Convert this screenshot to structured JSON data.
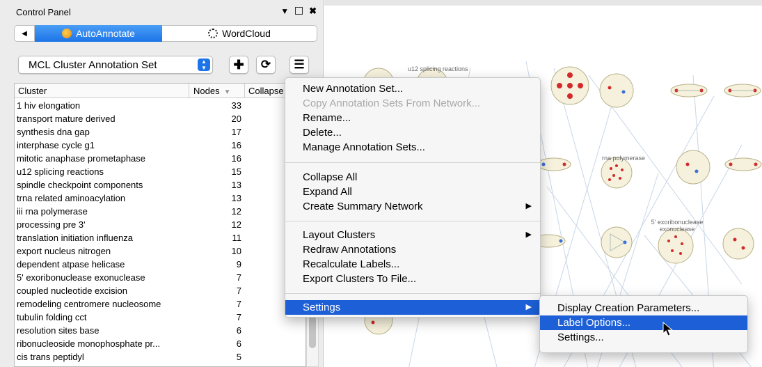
{
  "control_panel": {
    "title": "Control Panel",
    "header_icons": [
      "chevron-down-icon",
      "float-window-icon",
      "close-icon"
    ],
    "tabs": {
      "back_glyph": "◀",
      "autoannotate_label": "AutoAnnotate",
      "wordcloud_label": "WordCloud",
      "active": "AutoAnnotate"
    },
    "annotation_set_select": {
      "value": "MCL Cluster Annotation Set"
    },
    "toolbar_buttons": [
      "add-icon",
      "refresh-icon",
      "menu-icon"
    ],
    "table": {
      "columns": [
        "Cluster",
        "Nodes",
        "Collapse"
      ],
      "sort_column": "Nodes",
      "rows": [
        {
          "cluster": "1 hiv elongation",
          "nodes": "33"
        },
        {
          "cluster": "transport mature derived",
          "nodes": "20"
        },
        {
          "cluster": "synthesis dna gap",
          "nodes": "17"
        },
        {
          "cluster": "interphase cycle g1",
          "nodes": "16"
        },
        {
          "cluster": "mitotic anaphase prometaphase",
          "nodes": "16"
        },
        {
          "cluster": "u12 splicing reactions",
          "nodes": "15"
        },
        {
          "cluster": "spindle checkpoint components",
          "nodes": "13"
        },
        {
          "cluster": "trna related aminoacylation",
          "nodes": "13"
        },
        {
          "cluster": "iii rna polymerase",
          "nodes": "12"
        },
        {
          "cluster": "processing pre 3'",
          "nodes": "12"
        },
        {
          "cluster": "translation initiation influenza",
          "nodes": "11"
        },
        {
          "cluster": "export nucleus nitrogen",
          "nodes": "10"
        },
        {
          "cluster": "dependent atpase helicase",
          "nodes": "9"
        },
        {
          "cluster": "5' exoribonuclease exonuclease",
          "nodes": "7"
        },
        {
          "cluster": "coupled nucleotide excision",
          "nodes": "7"
        },
        {
          "cluster": "remodeling centromere nucleosome",
          "nodes": "7"
        },
        {
          "cluster": "tubulin folding cct",
          "nodes": "7"
        },
        {
          "cluster": "resolution sites base",
          "nodes": "6"
        },
        {
          "cluster": "ribonucleoside monophosphate pr...",
          "nodes": "6"
        },
        {
          "cluster": "cis trans peptidyl",
          "nodes": "5"
        }
      ]
    }
  },
  "network_view": {
    "cluster_labels": [
      "u12 splicing reactions",
      "rna polymerase",
      "5' exoribonuclease exonuclease"
    ]
  },
  "context_menu": {
    "items": [
      {
        "label": "New Annotation Set...",
        "enabled": true
      },
      {
        "label": "Copy Annotation Sets From Network...",
        "enabled": false
      },
      {
        "label": "Rename...",
        "enabled": true
      },
      {
        "label": "Delete...",
        "enabled": true
      },
      {
        "label": "Manage Annotation Sets...",
        "enabled": true
      },
      {
        "label": "Collapse All",
        "enabled": true
      },
      {
        "label": "Expand All",
        "enabled": true
      },
      {
        "label": "Create Summary Network",
        "enabled": true,
        "submenu": true
      },
      {
        "label": "Layout Clusters",
        "enabled": true,
        "submenu": true
      },
      {
        "label": "Redraw Annotations",
        "enabled": true
      },
      {
        "label": "Recalculate Labels...",
        "enabled": true
      },
      {
        "label": "Export Clusters To File...",
        "enabled": true
      },
      {
        "label": "Settings",
        "enabled": true,
        "submenu": true,
        "active": true
      }
    ],
    "submenu_arrow": "▶"
  },
  "settings_submenu": {
    "items": [
      {
        "label": "Display Creation Parameters...",
        "active": false
      },
      {
        "label": "Label Options...",
        "active": true
      },
      {
        "label": "Settings...",
        "active": false
      }
    ]
  },
  "colors": {
    "accent_blue": "#1c74e8",
    "menu_highlight": "#1c5fd6",
    "cluster_fill": "#f5f1dc",
    "node_red": "#d22a2a",
    "node_blue": "#3a6fd8"
  }
}
